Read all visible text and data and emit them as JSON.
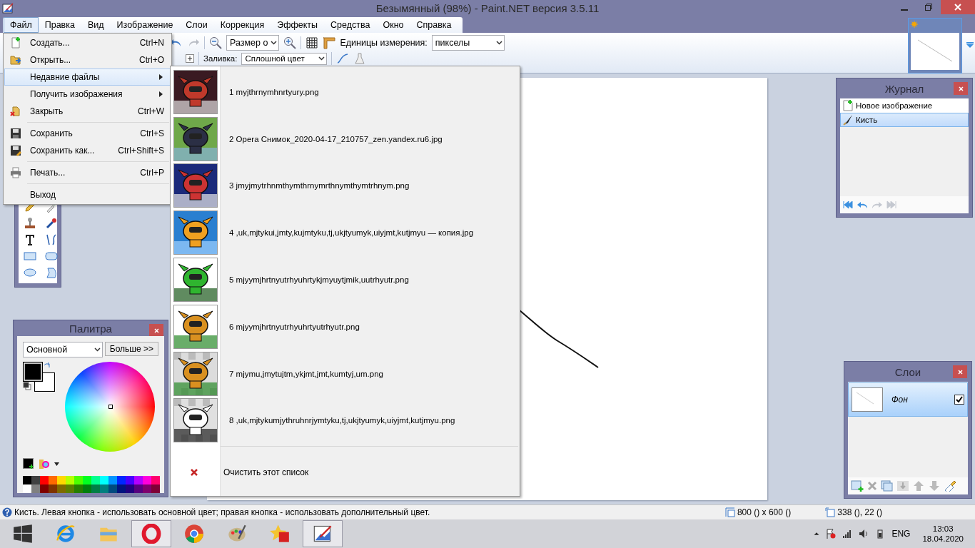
{
  "window": {
    "title": "Безымянный (98%) - Paint.NET версия 3.5.11"
  },
  "menu_bar": [
    {
      "label": "Файл",
      "selected": true
    },
    {
      "label": "Правка",
      "selected": false
    },
    {
      "label": "Вид",
      "selected": false
    },
    {
      "label": "Изображение",
      "selected": false
    },
    {
      "label": "Слои",
      "selected": false
    },
    {
      "label": "Коррекция",
      "selected": false
    },
    {
      "label": "Эффекты",
      "selected": false
    },
    {
      "label": "Средства",
      "selected": false
    },
    {
      "label": "Окно",
      "selected": false
    },
    {
      "label": "Справка",
      "selected": false
    }
  ],
  "toolbar": {
    "zoom_select": "Размер о",
    "units_label": "Единицы измерения:",
    "units_select": "пикселы",
    "fill_label": "Заливка:",
    "fill_select": "Сплошной цвет"
  },
  "file_menu": {
    "groups": [
      [
        {
          "kind": "new",
          "label": "Создать...",
          "shortcut": "Ctrl+N",
          "selected": false,
          "submenu": false
        },
        {
          "kind": "open",
          "label": "Открыть...",
          "shortcut": "Ctrl+O",
          "selected": false,
          "submenu": false
        },
        {
          "kind": "recent",
          "label": "Недавние файлы",
          "selected": true,
          "submenu": true
        },
        {
          "kind": "acquire",
          "label": "Получить изображения",
          "selected": false,
          "submenu": true
        },
        {
          "kind": "close",
          "label": "Закрыть",
          "shortcut": "Ctrl+W",
          "selected": false,
          "submenu": false
        }
      ],
      [
        {
          "kind": "save",
          "label": "Сохранить",
          "shortcut": "Ctrl+S",
          "selected": false,
          "submenu": false
        },
        {
          "kind": "save_as",
          "label": "Сохранить как...",
          "shortcut": "Ctrl+Shift+S",
          "selected": false,
          "submenu": false
        }
      ],
      [
        {
          "kind": "print",
          "label": "Печать...",
          "shortcut": "Ctrl+P",
          "selected": false,
          "submenu": false
        }
      ],
      [
        {
          "kind": "exit",
          "label": "Выход",
          "selected": false,
          "submenu": false
        }
      ]
    ]
  },
  "recent_files": {
    "items": [
      {
        "label": "1 myjthrnymhnrtyury.png"
      },
      {
        "label": "2 Opera Снимок_2020-04-17_210757_zen.yandex.ru6.jpg"
      },
      {
        "label": "3 jmyjmytrhnmthymthrnymrthnymthymtrhnym.png"
      },
      {
        "label": "4 ,uk,mjtykui,jmty,kujmtyku,tj,ukjtyumyk,uiyjmt,kutjmyu — копия.jpg"
      },
      {
        "label": "5 mjyymjhrtnyutrhyuhrtykjmyuytjmik,uutrhyutr.png"
      },
      {
        "label": "6 mjyymjhrtnyutrhyuhrtyutrhyutr.png"
      },
      {
        "label": "7 mjymu,jmytujtm,ykjmt,jmt,kumtyj,um.png"
      },
      {
        "label": "8 ,uk,mjtykumjythruhnrjymtyku,tj,ukjtyumyk,uiyjmt,kutjmyu.png"
      }
    ],
    "clear": "Очистить этот список"
  },
  "palette": {
    "title": "Палитра",
    "mode": "Основной",
    "more_button": "Больше >>"
  },
  "history": {
    "title": "Журнал",
    "items": [
      {
        "kind": "new",
        "label": "Новое изображение",
        "selected": false
      },
      {
        "kind": "brush",
        "label": "Кисть",
        "selected": true
      }
    ]
  },
  "layers": {
    "title": "Слои",
    "items": [
      {
        "name": "Фон",
        "selected": true,
        "visible": true
      }
    ]
  },
  "status_bar": {
    "hint": "Кисть. Левая кнопка - использовать основной цвет; правая кнопка - использовать дополнительный цвет.",
    "image_size": "800 () x 600 ()",
    "cursor": "338 (), 22 ()"
  },
  "taskbar": {
    "apps": [
      {
        "kind": "start",
        "selected": false
      },
      {
        "kind": "ie",
        "selected": false
      },
      {
        "kind": "explorer",
        "selected": false
      },
      {
        "kind": "opera",
        "selected": true
      },
      {
        "kind": "chrome",
        "selected": false
      },
      {
        "kind": "paint",
        "selected": false
      },
      {
        "kind": "star_app",
        "selected": false
      },
      {
        "kind": "paintnet",
        "selected": true
      }
    ],
    "language": "ENG",
    "time": "13:03",
    "date": "18.04.2020"
  }
}
